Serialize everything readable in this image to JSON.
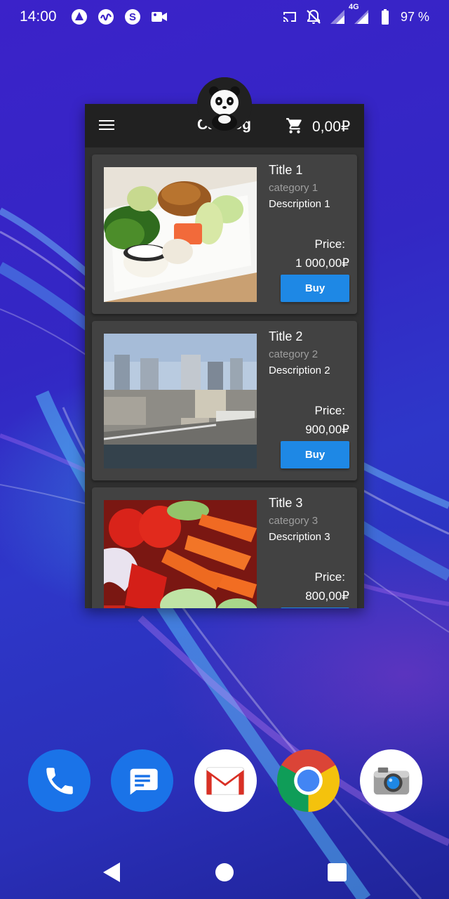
{
  "status_bar": {
    "time": "14:00",
    "left_icons": [
      "arcore-icon",
      "wave-app-icon",
      "skype-icon",
      "video-camera-icon"
    ],
    "right_icons": [
      "cast-icon",
      "notifications-off-icon",
      "signal-icon",
      "lte-signal-icon",
      "battery-icon"
    ],
    "network_label": "4G",
    "battery_percent": "97 %"
  },
  "app": {
    "title": "Catalog",
    "cart_total": "0,00₽",
    "menu_icon": "hamburger-menu-icon",
    "cart_icon": "shopping-cart-icon",
    "logo": "panda-logo",
    "price_label": "Price:",
    "buy_label": "Buy",
    "products": [
      {
        "title": "Title 1",
        "category": "category 1",
        "description": "Description 1",
        "price": "1 000,00₽",
        "image": "sushi-photo"
      },
      {
        "title": "Title 2",
        "category": "category 2",
        "description": "Description 2",
        "price": "900,00₽",
        "image": "city-photo"
      },
      {
        "title": "Title 3",
        "category": "category 3",
        "description": "Description 3",
        "price": "800,00₽",
        "image": "vegetables-photo"
      }
    ]
  },
  "dock": {
    "apps": [
      "phone-app",
      "messages-app",
      "gmail-app",
      "chrome-app",
      "camera-app"
    ]
  },
  "nav_bar": {
    "buttons": [
      "back-button",
      "home-button",
      "recents-button"
    ]
  },
  "colors": {
    "accent": "#1e88e5",
    "app_bar": "#212121",
    "card": "#424242",
    "app_background": "#303030"
  }
}
